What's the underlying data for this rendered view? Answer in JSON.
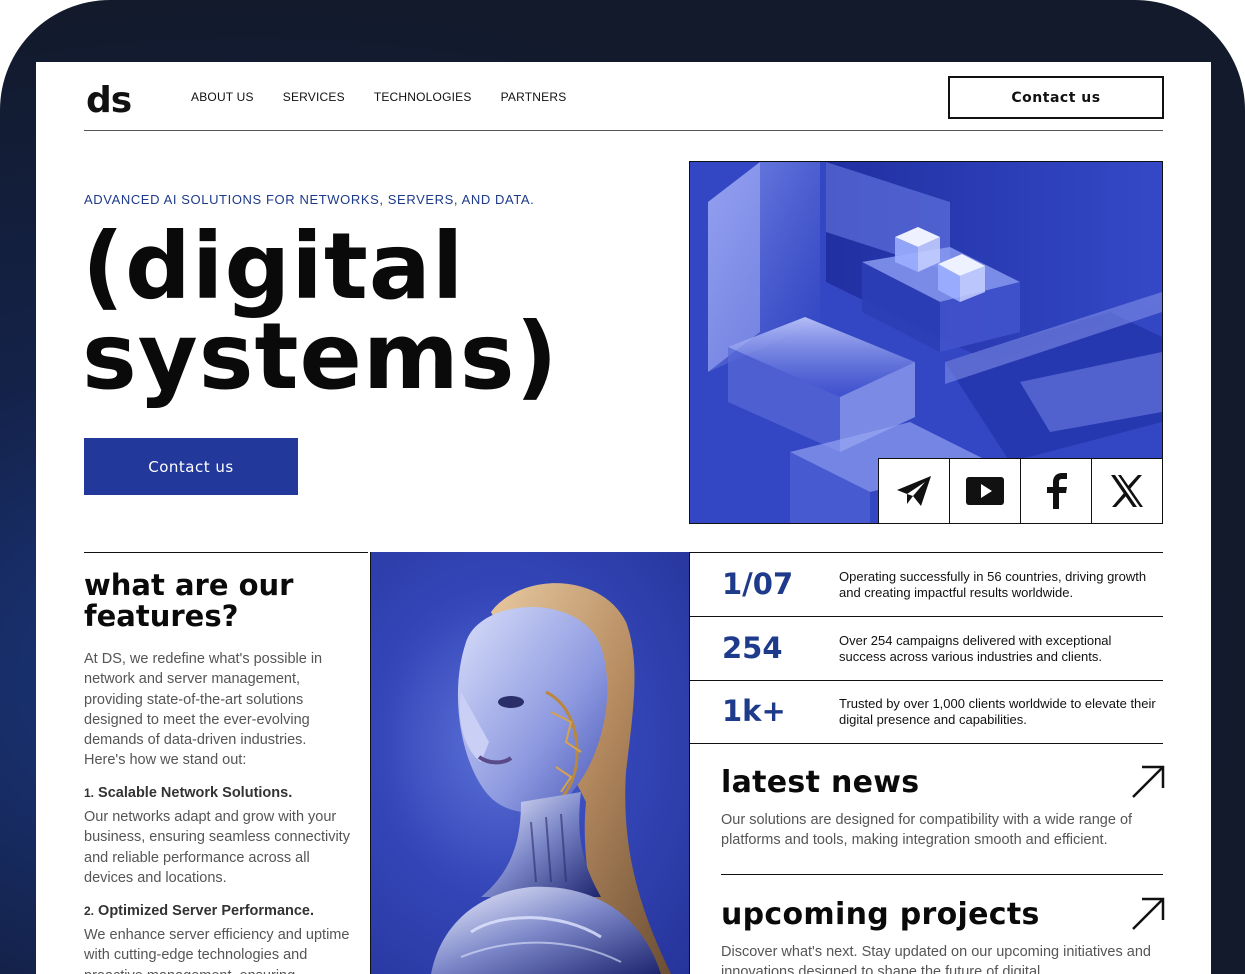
{
  "header": {
    "logo": "ds",
    "nav": [
      "ABOUT US",
      "SERVICES",
      "TECHNOLOGIES",
      "PARTNERS"
    ],
    "contact_label": "Contact us"
  },
  "hero": {
    "tagline": "ADVANCED AI SOLUTIONS FOR NETWORKS, SERVERS, AND DATA.",
    "title_line1": "(digital",
    "title_line2": "systems)",
    "button_label": "Contact us"
  },
  "social": {
    "icons": [
      "telegram-icon",
      "youtube-icon",
      "facebook-icon",
      "x-icon"
    ]
  },
  "features": {
    "title_line1": "what are our",
    "title_line2": "features?",
    "intro": "At DS, we redefine what's possible in network and server management, providing state-of-the-art solutions designed to meet the ever-evolving demands of data-driven industries. Here's how we stand out:",
    "items": [
      {
        "number": "1.",
        "heading": "Scalable Network Solutions.",
        "body": "Our networks adapt and grow with your business, ensuring seamless connectivity and reliable performance across all devices and locations."
      },
      {
        "number": "2.",
        "heading": "Optimized Server Performance.",
        "body": "We enhance server efficiency and uptime with cutting-edge technologies and proactive management, ensuring"
      }
    ]
  },
  "stats": [
    {
      "value": "1/07",
      "text": "Operating successfully in 56 countries, driving growth and creating impactful results worldwide."
    },
    {
      "value": "254",
      "text": "Over 254 campaigns delivered with exceptional success across various industries and clients."
    },
    {
      "value": "1k+",
      "text": "Trusted by over 1,000 clients worldwide to elevate their digital presence and capabilities."
    }
  ],
  "news": {
    "title": "latest news",
    "body": "Our solutions are designed for compatibility with a wide range of platforms and tools, making integration smooth and efficient."
  },
  "projects": {
    "title": "upcoming projects",
    "body": "Discover what's next. Stay updated on our upcoming initiatives and innovations designed to shape the future of digital"
  },
  "colors": {
    "accent": "#22389a",
    "accent_text": "#1e3a8a",
    "frame": "#121a2c"
  }
}
